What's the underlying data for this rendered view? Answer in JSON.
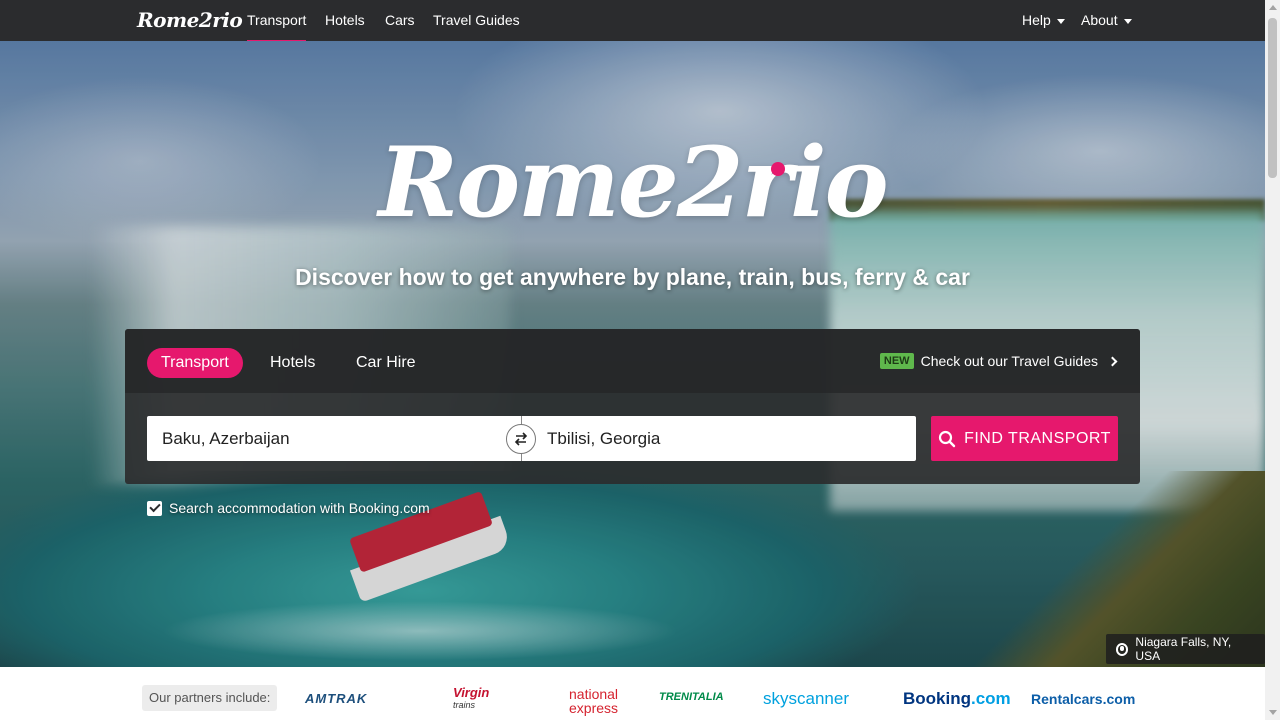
{
  "nav": {
    "brand": "Rome2rio",
    "links": [
      "Transport",
      "Hotels",
      "Cars",
      "Travel Guides"
    ],
    "active": "Transport",
    "help": "Help",
    "about": "About"
  },
  "hero": {
    "logo_text": "Rome2rio",
    "tagline": "Discover how to get anywhere by plane, train, bus, ferry & car",
    "location_caption": "Niagara Falls, NY, USA"
  },
  "search": {
    "tabs": [
      "Transport",
      "Hotels",
      "Car Hire"
    ],
    "active_tab": "Transport",
    "promo_badge": "NEW",
    "promo_text": "Check out our Travel Guides",
    "from_value": "Baku, Azerbaijan",
    "to_value": "Tbilisi, Georgia",
    "swap_icon": "swap-arrows-icon",
    "button_label": "FIND TRANSPORT",
    "button_icon": "search-icon",
    "accommodation_checkbox_label": "Search accommodation with Booking.com",
    "accommodation_checked": true
  },
  "partners": {
    "label": "Our partners include:",
    "logos": [
      "AMTRAK",
      "Virgin",
      "trains",
      "national",
      "express",
      "TRENITALIA",
      "skyscanner",
      "Booking",
      ".com",
      "Rentalcars.com"
    ]
  },
  "colors": {
    "accent": "#e6186d",
    "nav_bg": "#2b2c2e",
    "new_badge": "#5fb84c"
  }
}
